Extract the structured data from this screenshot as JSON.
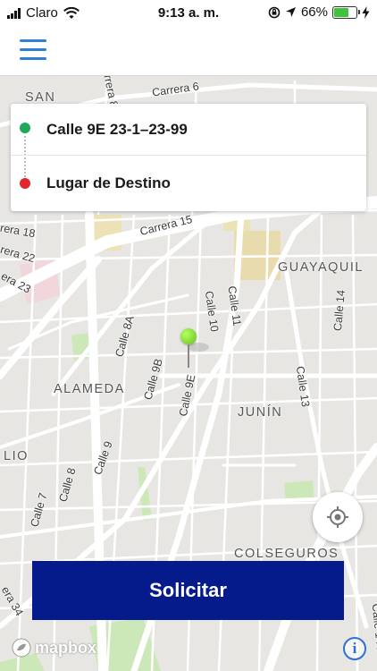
{
  "status_bar": {
    "carrier": "Claro",
    "time": "9:13 a. m.",
    "battery_percent": "66%",
    "battery_level": 0.66,
    "icons": [
      "signal-icon",
      "wifi-icon",
      "orientation-lock-icon",
      "location-arrow-icon",
      "battery-icon",
      "charging-icon"
    ]
  },
  "nav": {
    "menu_icon": "hamburger-menu-icon"
  },
  "trip": {
    "origin": "Calle 9E 23-1–23-99",
    "destination": "Lugar de Destino",
    "origin_color": "#1fa855",
    "destination_color": "#e3262e"
  },
  "map": {
    "districts": {
      "san": "SAN",
      "guayaquil": "GUAYAQUIL",
      "alameda": "ALAMEDA",
      "junin": "JUNÍN",
      "lio": "LIO",
      "colseguros": "COLSEGUROS"
    },
    "streets": {
      "carrera15": "Carrera 15",
      "carrera18": "rera 18",
      "carrera22": "rera 22",
      "carrera23": "era 23",
      "carrera34": "era 34",
      "calle14": "Calle 14",
      "calle13": "Calle 13",
      "calle11": "Calle 11",
      "calle10": "Calle 10",
      "calle9e": "Calle 9E",
      "calle9b": "Calle 9B",
      "calle8a": "Calle 8A",
      "calle9": "Calle 9",
      "calle8": "Calle 8",
      "calle7": "Calle 7",
      "calle14c": "Calle 14C",
      "carrera_top": "Carrera 8",
      "carrera_top2": "Carrera 6"
    },
    "attribution": "mapbox",
    "info": "i"
  },
  "actions": {
    "request_label": "Solicitar",
    "locate_icon": "crosshair-locate-icon"
  },
  "colors": {
    "accent_blue": "#2f7fd6",
    "button_navy": "#051b8c",
    "pin_green": "#7ed321"
  }
}
